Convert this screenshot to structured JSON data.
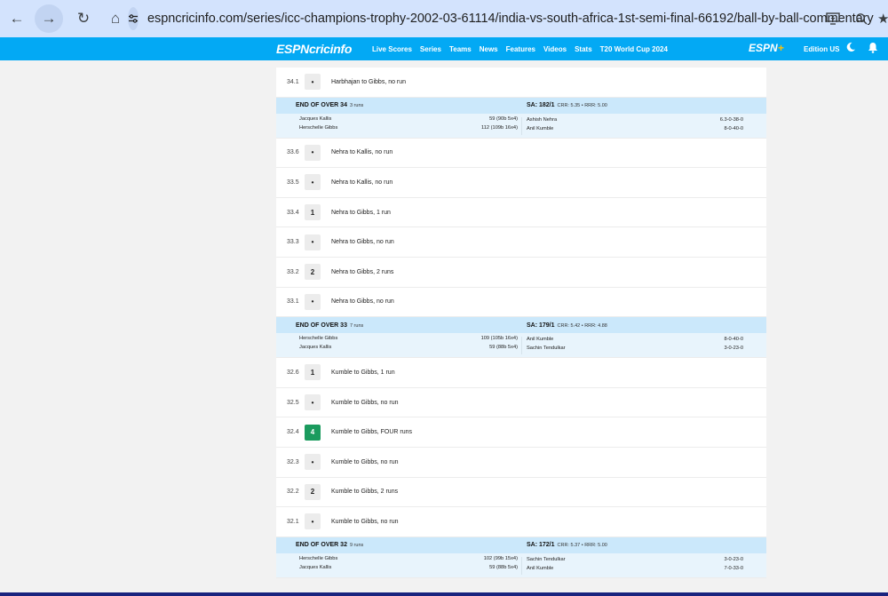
{
  "browser": {
    "url": "espncricinfo.com/series/icc-champions-trophy-2002-03-61114/india-vs-south-africa-1st-semi-final-66192/ball-by-ball-commentary"
  },
  "nav": {
    "logo": "cricinfo",
    "links": [
      "Live Scores",
      "Series",
      "Teams",
      "News",
      "Features",
      "Videos",
      "Stats",
      "T20 World Cup 2024"
    ],
    "edition": "Edition US"
  },
  "feed": [
    {
      "type": "ball",
      "over": "34.1",
      "result": "•",
      "text": "Harbhajan to Gibbs, no run"
    },
    {
      "type": "eoo",
      "label": "END OF OVER 34",
      "runs": "3 runs",
      "score": "SA: 182/1",
      "rates": "CRR: 5.35 • RRR: 5.00",
      "batters": [
        {
          "name": "Jacques Kallis",
          "stat": "59 (90b 5x4)"
        },
        {
          "name": "Herschelle Gibbs",
          "stat": "112 (109b 16x4)"
        }
      ],
      "bowlers": [
        {
          "name": "Ashish Nehra",
          "stat": "6.3-0-38-0"
        },
        {
          "name": "Anil Kumble",
          "stat": "8-0-40-0"
        }
      ]
    },
    {
      "type": "ball",
      "over": "33.6",
      "result": "•",
      "text": "Nehra to Kallis, no run"
    },
    {
      "type": "ball",
      "over": "33.5",
      "result": "•",
      "text": "Nehra to Kallis, no run"
    },
    {
      "type": "ball",
      "over": "33.4",
      "result": "1",
      "text": "Nehra to Gibbs, 1 run"
    },
    {
      "type": "ball",
      "over": "33.3",
      "result": "•",
      "text": "Nehra to Gibbs, no run"
    },
    {
      "type": "ball",
      "over": "33.2",
      "result": "2",
      "text": "Nehra to Gibbs, 2 runs"
    },
    {
      "type": "ball",
      "over": "33.1",
      "result": "•",
      "text": "Nehra to Gibbs, no run"
    },
    {
      "type": "eoo",
      "label": "END OF OVER 33",
      "runs": "7 runs",
      "score": "SA: 179/1",
      "rates": "CRR: 5.42 • RRR: 4.88",
      "batters": [
        {
          "name": "Herschelle Gibbs",
          "stat": "109 (105b 16x4)"
        },
        {
          "name": "Jacques Kallis",
          "stat": "59 (88b 5x4)"
        }
      ],
      "bowlers": [
        {
          "name": "Anil Kumble",
          "stat": "8-0-40-0"
        },
        {
          "name": "Sachin Tendulkar",
          "stat": "3-0-23-0"
        }
      ]
    },
    {
      "type": "ball",
      "over": "32.6",
      "result": "1",
      "text": "Kumble to Gibbs, 1 run"
    },
    {
      "type": "ball",
      "over": "32.5",
      "result": "•",
      "text": "Kumble to Gibbs, no run"
    },
    {
      "type": "ball",
      "over": "32.4",
      "result": "4",
      "text": "Kumble to Gibbs, FOUR runs",
      "four": true
    },
    {
      "type": "ball",
      "over": "32.3",
      "result": "•",
      "text": "Kumble to Gibbs, no run"
    },
    {
      "type": "ball",
      "over": "32.2",
      "result": "2",
      "text": "Kumble to Gibbs, 2 runs"
    },
    {
      "type": "ball",
      "over": "32.1",
      "result": "•",
      "text": "Kumble to Gibbs, no run"
    },
    {
      "type": "eoo",
      "label": "END OF OVER 32",
      "runs": "9 runs",
      "score": "SA: 172/1",
      "rates": "CRR: 5.37 • RRR: 5.00",
      "batters": [
        {
          "name": "Herschelle Gibbs",
          "stat": "102 (99b 15x4)"
        },
        {
          "name": "Jacques Kallis",
          "stat": "59 (88b 5x4)"
        }
      ],
      "bowlers": [
        {
          "name": "Sachin Tendulkar",
          "stat": "3-0-23-0"
        },
        {
          "name": "Anil Kumble",
          "stat": "7-0-33-0"
        }
      ]
    }
  ]
}
